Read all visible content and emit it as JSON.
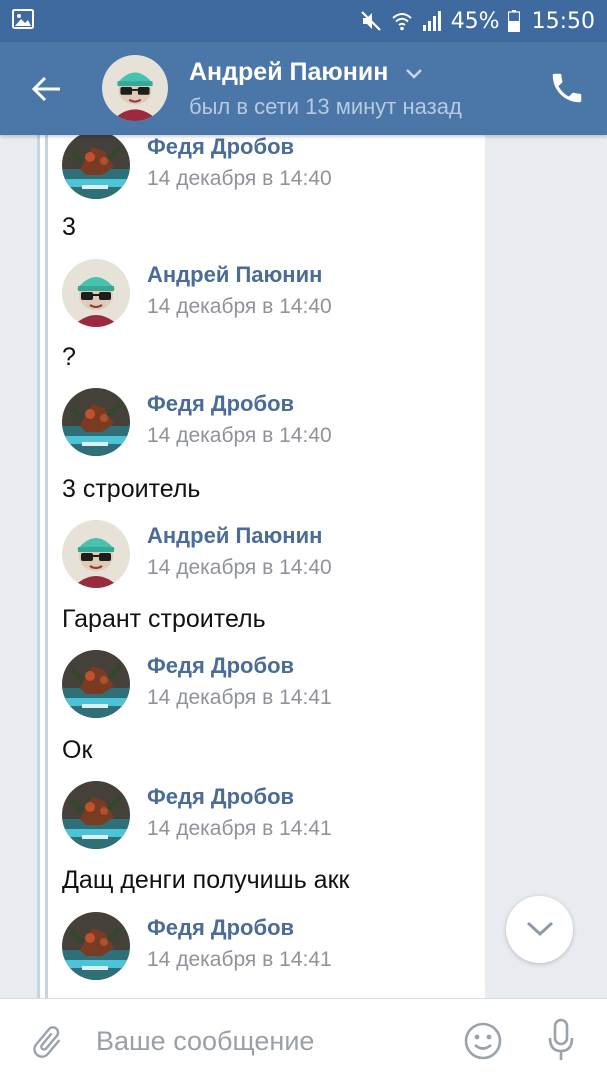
{
  "status_bar": {
    "battery": "45%",
    "time": "15:50"
  },
  "header": {
    "name": "Андрей Паюнин",
    "status": "был в сети 13 минут назад"
  },
  "messages": [
    {
      "author": "Федя Дробов",
      "time": "14 декабря в 14:40",
      "avatar": "fedya",
      "text": "3"
    },
    {
      "author": "Андрей Паюнин",
      "time": "14 декабря в 14:40",
      "avatar": "andrey",
      "text": "?"
    },
    {
      "author": "Федя Дробов",
      "time": "14 декабря в 14:40",
      "avatar": "fedya",
      "text": "3 строитель"
    },
    {
      "author": "Андрей Паюнин",
      "time": "14 декабря в 14:40",
      "avatar": "andrey",
      "text": "Гарант строитель"
    },
    {
      "author": "Федя Дробов",
      "time": "14 декабря в 14:41",
      "avatar": "fedya",
      "text": "Ок"
    },
    {
      "author": "Федя Дробов",
      "time": "14 декабря в 14:41",
      "avatar": "fedya",
      "text": "Дащ денги получишь акк"
    },
    {
      "author": "Федя Дробов",
      "time": "14 декабря в 14:41",
      "avatar": "fedya",
      "text": ""
    }
  ],
  "input": {
    "placeholder": "Ваше сообщение",
    "value": ""
  },
  "colors": {
    "header": "#4a76a8",
    "status_bar": "#3f6aa0",
    "author_name": "#4a6c96",
    "background": "#e8ecf1"
  },
  "icons": [
    "gallery-icon",
    "mute-icon",
    "wifi-icon",
    "signal-icon",
    "battery-icon",
    "back-arrow-icon",
    "chevron-down-icon",
    "phone-icon",
    "paperclip-icon",
    "smiley-icon",
    "microphone-icon"
  ]
}
